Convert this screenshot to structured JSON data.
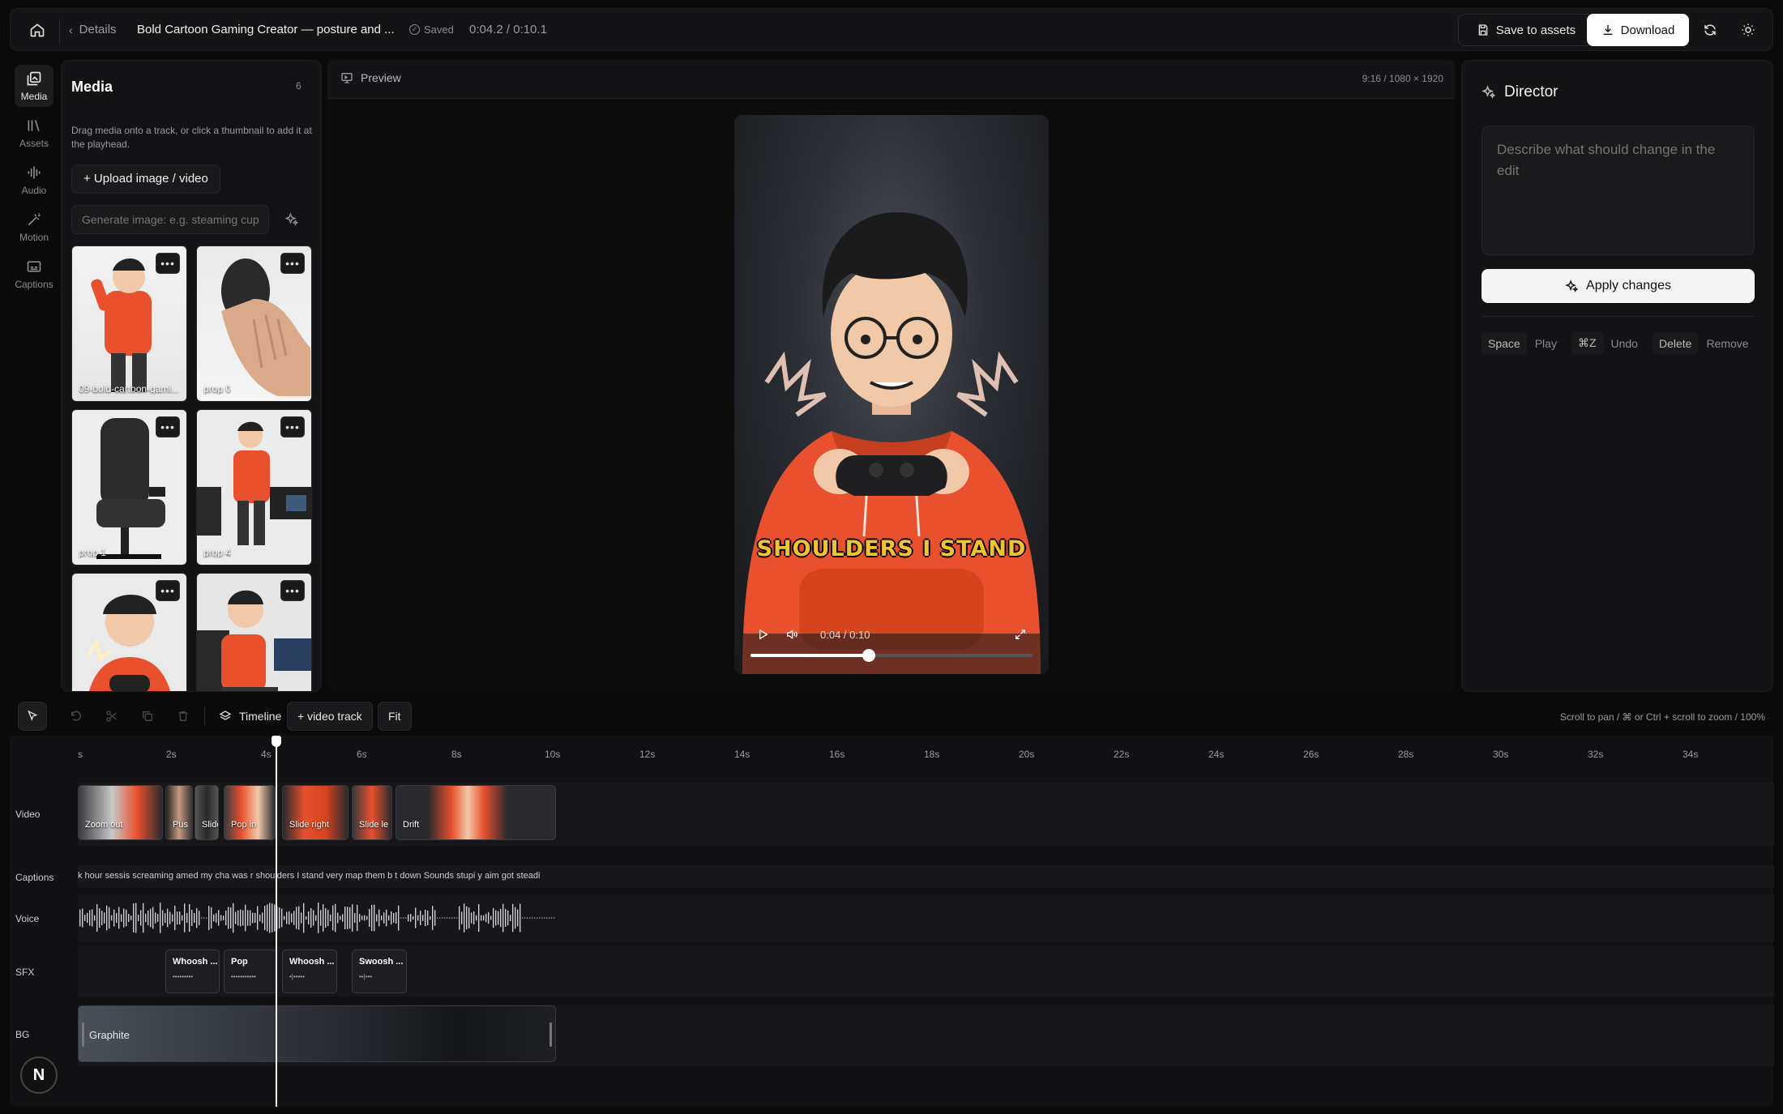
{
  "header": {
    "back_label": "Details",
    "project_title": "Bold Cartoon Gaming Creator — posture and ...",
    "save_status": "Saved",
    "time_display": "0:04.2 / 0:10.1",
    "save_to_assets_label": "Save to assets",
    "download_label": "Download"
  },
  "rail": {
    "items": [
      {
        "label": "Media",
        "icon": "media-icon"
      },
      {
        "label": "Assets",
        "icon": "library-icon"
      },
      {
        "label": "Audio",
        "icon": "audio-icon"
      },
      {
        "label": "Motion",
        "icon": "wand-icon"
      },
      {
        "label": "Captions",
        "icon": "captions-icon"
      }
    ]
  },
  "media": {
    "title": "Media",
    "count": "6",
    "hint": "Drag media onto a track, or click a thumbnail to add it at the playhead.",
    "upload_label": "+ Upload image / video",
    "generate_placeholder": "Generate image: e.g. steaming cup of",
    "thumbs": [
      {
        "label": "09-bold-cartoon-gami..."
      },
      {
        "label": "prop 0"
      },
      {
        "label": "prop 1"
      },
      {
        "label": "prop 4"
      },
      {
        "label": ""
      },
      {
        "label": ""
      }
    ]
  },
  "preview": {
    "label": "Preview",
    "aspect": "9:16 / 1080 × 1920",
    "caption": "SHOULDERS I STAND",
    "player_time": "0:04 / 0:10",
    "progress": 0.42
  },
  "director": {
    "title": "Director",
    "placeholder": "Describe what should change in the edit",
    "apply_label": "Apply changes",
    "shortcuts": [
      {
        "key": "Space",
        "action": "Play"
      },
      {
        "key": "⌘Z",
        "action": "Undo"
      },
      {
        "key": "Delete",
        "action": "Remove"
      }
    ]
  },
  "timeline": {
    "tab_label": "Timeline",
    "add_track_label": "+ video track",
    "fit_label": "Fit",
    "hint": "Scroll to pan / ⌘ or Ctrl + scroll to zoom / 100%",
    "ticks": [
      "s",
      "2s",
      "4s",
      "6s",
      "8s",
      "10s",
      "12s",
      "14s",
      "16s",
      "18s",
      "20s",
      "22s",
      "24s",
      "26s",
      "28s",
      "30s",
      "32s",
      "34s"
    ],
    "tracks": {
      "video": "Video",
      "captions": "Captions",
      "voice": "Voice",
      "sfx": "SFX",
      "bg": "BG"
    },
    "video_clips": [
      "Zoom out",
      "Pus",
      "Slide",
      "Pop in",
      "Slide right",
      "Slide le",
      "Drift"
    ],
    "caption_text": "k hour sessis screaming  amed my cha  was r  shoulders I stand  very map  them b  t down Sounds stupi    y aim got steadi",
    "sfx_clips": [
      "Whoosh ...",
      "Pop",
      "Whoosh ...",
      "Swoosh ..."
    ],
    "bg_clip": "Graphite"
  },
  "avatar": {
    "initial": "N"
  },
  "colors": {
    "accent_hoodie": "#e8502e",
    "caption_yellow": "#f2c230"
  }
}
